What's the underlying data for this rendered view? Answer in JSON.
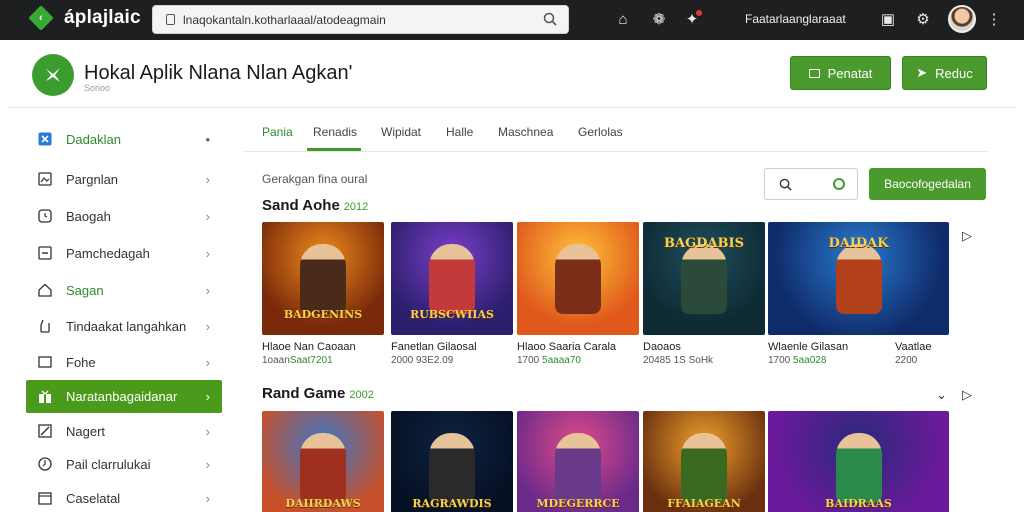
{
  "browser": {
    "app_name": "áplajlaic",
    "url": "lnaqokantaln.kotharlaaal/atodeagmain",
    "user_label": "Faatarlaanglaraaat"
  },
  "header": {
    "title": "Hokal Aplik Nlana Nlan Agkan'",
    "subtitle": "Sorioo",
    "btn_primary": "Penatat",
    "btn_secondary": "Reduc"
  },
  "sidebar": {
    "items": [
      {
        "label": "Dadaklan",
        "icon": "grid-icon"
      },
      {
        "label": "Pargnlan",
        "icon": "image-icon"
      },
      {
        "label": "Baogah",
        "icon": "clock-icon"
      },
      {
        "label": "Pamchedagah",
        "icon": "minus-box-icon"
      },
      {
        "label": "Sagan",
        "icon": "home-icon"
      },
      {
        "label": "Tindaakat langahkan",
        "icon": "hand-icon"
      },
      {
        "label": "Fohe",
        "icon": "folder-icon"
      },
      {
        "label": "Naratanbagaidanar",
        "icon": "gift-icon"
      },
      {
        "label": "Nagert",
        "icon": "edit-icon"
      },
      {
        "label": "Pail clarrulukai",
        "icon": "clock-alt-icon"
      },
      {
        "label": "Caselatal",
        "icon": "calendar-icon"
      }
    ]
  },
  "tabs": [
    "Pania",
    "Renadis",
    "Wipidat",
    "Halle",
    "Maschnea",
    "Gerlolas"
  ],
  "section_caption": "Gerakgan fina oural",
  "recommend_button": "Baocofogedalan",
  "rows": [
    {
      "title": "Sand Aohe",
      "year": "2012",
      "cards": [
        {
          "name": "Hlaoe Nan Caoaan",
          "meta": "1oaan",
          "rating": "Saat7201",
          "art": "BADGENINS",
          "colors": [
            "#f08a1c",
            "#7a2a0a",
            "#2a1208"
          ],
          "fig": "#4a2a18"
        },
        {
          "name": "Fanetlan Gilaosal",
          "meta": "2000 93E2.09",
          "rating": "",
          "art": "RUBSCWIIAS",
          "colors": [
            "#7b3ec9",
            "#2c1f6e",
            "#c0367a"
          ],
          "fig": "#c23a3a"
        },
        {
          "name": "Hlaoo Saaria Carala",
          "meta": "1700 ",
          "rating": "5aaaa70",
          "art": "",
          "colors": [
            "#ffc23a",
            "#e0581c",
            "#b52a14"
          ],
          "fig": "#7a2e18"
        },
        {
          "name": "Daoaos",
          "meta": "20485 1S SoHk",
          "rating": "",
          "art": "BAGDABIS",
          "colors": [
            "#1f4e5e",
            "#0e2a33",
            "#3c7a2c"
          ],
          "fig": "#2c4a3a"
        },
        {
          "name": "Wlaenle Gilasan",
          "meta": "1700 ",
          "rating": "5aa028",
          "art": "DAIDAK",
          "colors": [
            "#2a7ad0",
            "#0f2c6a",
            "#7a2aa8"
          ],
          "fig": "#b2401a"
        },
        {
          "name": "Vaatlae",
          "meta": "2200 ",
          "rating": "",
          "art": "",
          "colors": [],
          "fig": ""
        }
      ]
    },
    {
      "title": "Rand Game",
      "year": "2002",
      "cards": [
        {
          "name": "",
          "meta": "",
          "rating": "",
          "art": "DAIIRDAWS",
          "colors": [
            "#3a78c8",
            "#c8502a",
            "#2a1410"
          ],
          "fig": "#a0301e"
        },
        {
          "name": "",
          "meta": "",
          "rating": "",
          "art": "RAGRAWDIS",
          "colors": [
            "#0e2240",
            "#061024",
            "#1a3a66"
          ],
          "fig": "#2a2a2a"
        },
        {
          "name": "",
          "meta": "",
          "rating": "",
          "art": "MDEGERRCE",
          "colors": [
            "#e04a8a",
            "#6a2a8a",
            "#f0a03a"
          ],
          "fig": "#6a3a8a"
        },
        {
          "name": "",
          "meta": "",
          "rating": "",
          "art": "FFAIAGEAN",
          "colors": [
            "#f0a02a",
            "#6a3010",
            "#2a5a1a"
          ],
          "fig": "#3a6a20"
        },
        {
          "name": "",
          "meta": "",
          "rating": "",
          "art": "BAIDRAAS",
          "colors": [
            "#2a2a7a",
            "#6a1a9a",
            "#1ab06a"
          ],
          "fig": "#2a8a4a"
        }
      ]
    }
  ],
  "colors": {
    "accent": "#4a9a2d",
    "topbar": "#1e1f21",
    "accent_text": "#2e8b2e"
  }
}
